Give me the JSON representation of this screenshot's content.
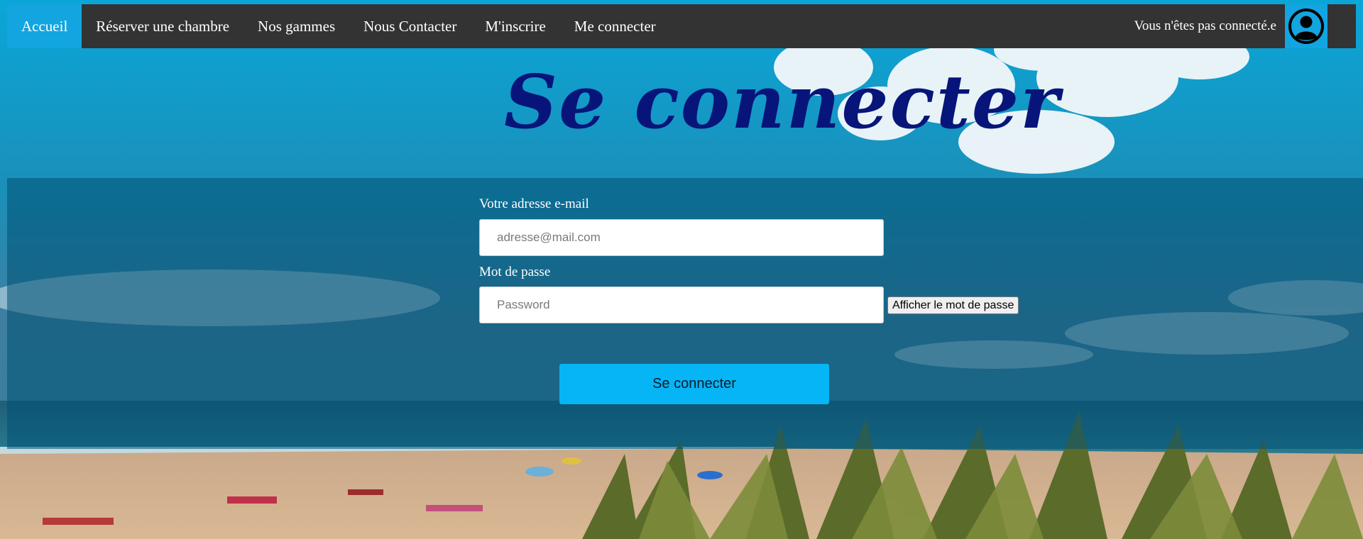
{
  "nav": {
    "items": [
      {
        "label": "Accueil",
        "active": true
      },
      {
        "label": "Réserver une chambre",
        "active": false
      },
      {
        "label": "Nos gammes",
        "active": false
      },
      {
        "label": "Nous Contacter",
        "active": false
      },
      {
        "label": "M'inscrire",
        "active": false
      },
      {
        "label": "Me connecter",
        "active": false
      }
    ],
    "status": "Vous n'êtes pas connecté.e",
    "avatar_icon": "user-circle-icon"
  },
  "page": {
    "title": "Se connecter"
  },
  "form": {
    "email": {
      "label": "Votre adresse e-mail",
      "placeholder": "adresse@mail.com",
      "value": ""
    },
    "password": {
      "label": "Mot de passe",
      "placeholder": "Password",
      "value": "",
      "show_button_label": "Afficher le mot de passe"
    },
    "submit_label": "Se connecter"
  },
  "colors": {
    "nav_bg": "#333333",
    "accent": "#12a5df",
    "title": "#07157a",
    "submit_bg": "#06b5f5"
  }
}
